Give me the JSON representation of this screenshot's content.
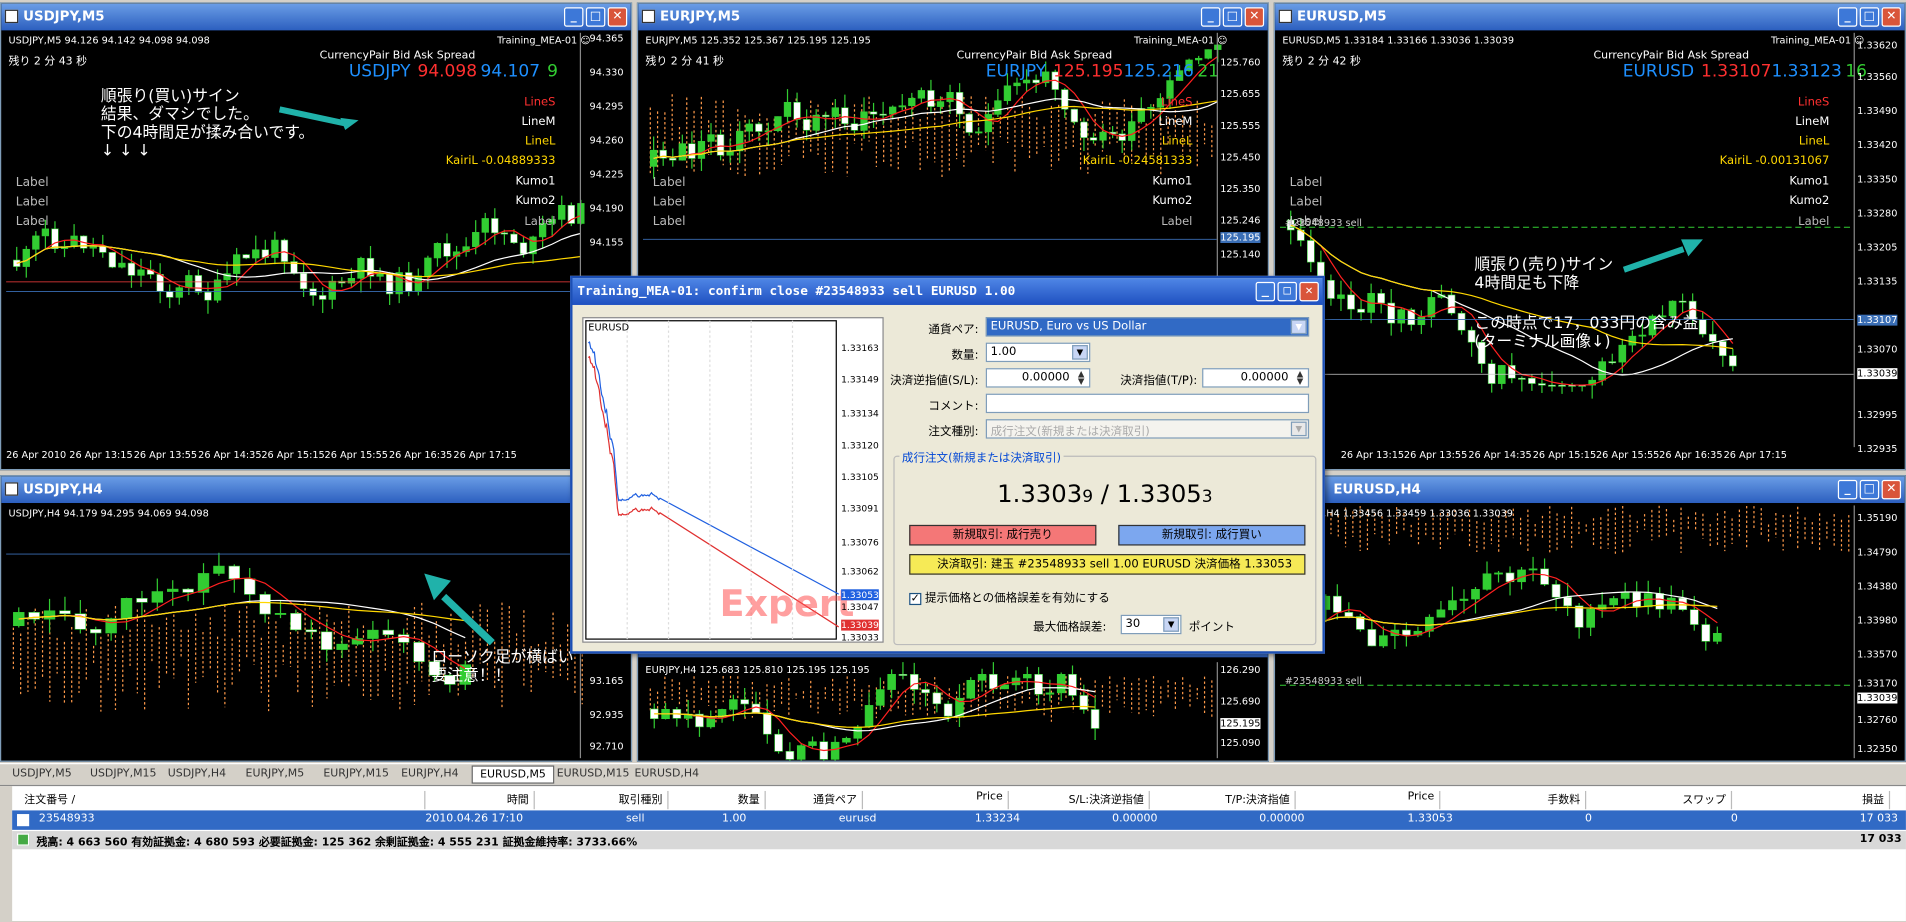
{
  "colors": {
    "bull_candle": "#32cd32",
    "bear_candle": "#ffffff",
    "ma_fast": "#ff2020",
    "ma_slow": "#ffffff",
    "ma_yellow": "#ffd700",
    "kumo": "#ff9a4a",
    "annotation_arrow": "#20b2aa"
  },
  "windows": {
    "usdjpy_m5": {
      "title": "USDJPY,M5",
      "header": "USDJPY,M5  94.126 94.142 94.098 94.098",
      "remaining": "残り 2 分 43 秒",
      "ea": "Training_MEA-01 ☺",
      "qh": "CurrencyPair        Bid         Ask    Spread",
      "sym": "USDJPY",
      "bid": "94.098",
      "ask": "94.107",
      "spread": "9",
      "ind": [
        "LineS",
        "LineM",
        "LineL",
        "KairiL  -0.04889333",
        "Kumo1",
        "Kumo2",
        "Label"
      ],
      "labels": [
        "Label",
        "Label",
        "Label"
      ],
      "prices": [
        "94.365",
        "94.330",
        "94.295",
        "94.260",
        "94.225",
        "94.190",
        "94.155"
      ],
      "times": [
        "26 Apr 2010",
        "26 Apr 13:15",
        "26 Apr 13:55",
        "26 Apr 14:35",
        "26 Apr 15:15",
        "26 Apr 15:55",
        "26 Apr 16:35",
        "26 Apr 17:15"
      ],
      "note": [
        "順張り(買い)サイン",
        "結果、ダマシでした。",
        "下の4時間足が揉み合いです。",
        "↓  ↓  ↓"
      ]
    },
    "eurjpy_m5": {
      "title": "EURJPY,M5",
      "header": "EURJPY,M5  125.352 125.367 125.195 125.195",
      "remaining": "残り 2 分 41 秒",
      "ea": "Training_MEA-01 ☺",
      "qh": "CurrencyPair        Bid         Ask    Spread",
      "sym": "EURJPY",
      "bid": "125.195",
      "ask": "125.216",
      "spread": "21",
      "ind": [
        "LineS",
        "LineM",
        "LineL",
        "KairiL  -0.24581333",
        "Kumo1",
        "Kumo2",
        "Label"
      ],
      "labels": [
        "Label",
        "Label",
        "Label"
      ],
      "prices": [
        "125.760",
        "125.655",
        "125.555",
        "125.450",
        "125.350",
        "125.246",
        "125.195",
        "125.140"
      ]
    },
    "eurusd_m5": {
      "title": "EURUSD,M5",
      "header": "EURUSD,M5  1.33184 1.33166 1.33036 1.33039",
      "remaining": "残り 2 分 42 秒",
      "ea": "Training_MEA-01 ☺",
      "qh": "CurrencyPair        Bid         Ask    Spread",
      "sym": "EURUSD",
      "bid": "1.33107",
      "ask": "1.33123",
      "spread": "16",
      "ind": [
        "LineS",
        "LineM",
        "LineL",
        "KairiL  -0.00131067",
        "Kumo1",
        "Kumo2",
        "Label"
      ],
      "labels": [
        "Label",
        "Label",
        "Label"
      ],
      "order": "#23548933 sell",
      "prices": [
        "1.33620",
        "1.33560",
        "1.33490",
        "1.33420",
        "1.33350",
        "1.33280",
        "1.33205",
        "1.33135",
        "1.33107",
        "1.33070",
        "1.33039",
        "1.32995",
        "1.32935"
      ],
      "times": [
        "26 Apr 13:15",
        "26 Apr 13:55",
        "26 Apr 14:35",
        "26 Apr 15:15",
        "26 Apr 15:55",
        "26 Apr 16:35",
        "26 Apr 17:15"
      ],
      "note1": [
        "順張り(売り)サイン",
        "4時間足も下降"
      ],
      "note2": [
        "この時点で17，033円の含み益",
        "(ターミナル画像↓)"
      ]
    },
    "usdjpy_h4": {
      "title": "USDJPY,H4",
      "header": "USDJPY,H4  94.179 94.295 94.069 94.098",
      "prices": [
        "93.165",
        "92.935",
        "92.710"
      ],
      "note": [
        "ローソク足が横ばい",
        "要注意！！"
      ]
    },
    "eurjpy_h4": {
      "header": "EURJPY,H4  125.683 125.810 125.195 125.195",
      "prices": [
        "126.290",
        "125.690",
        "125.195",
        "125.090"
      ]
    },
    "eurusd_h4": {
      "title": "EURUSD,H4",
      "header": "EURUSD,H4  1.33456 1.33459 1.33036 1.33039",
      "order": "#23548933 sell",
      "prices": [
        "1.35190",
        "1.34790",
        "1.34380",
        "1.33980",
        "1.33570",
        "1.33170",
        "1.33039",
        "1.32760",
        "1.32350"
      ]
    }
  },
  "dialog": {
    "title": "Training_MEA-01: confirm close #23548933 sell EURUSD 1.00",
    "mini_symbol": "EURUSD",
    "mini_prices": [
      "1.33163",
      "1.33149",
      "1.33134",
      "1.33120",
      "1.33105",
      "1.33091",
      "1.33076",
      "1.33062",
      "1.33053",
      "1.33047",
      "1.33039",
      "1.33033"
    ],
    "watermark": "Expert",
    "pair_label": "通貨ペア:",
    "pair_value": "EURUSD, Euro vs US Dollar",
    "qty_label": "数量:",
    "qty_value": "1.00",
    "sl_label": "決済逆指値(S/L):",
    "sl_value": "0.00000",
    "tp_label": "決済指値(T/P):",
    "tp_value": "0.00000",
    "comment_label": "コメント:",
    "type_label": "注文種別:",
    "type_value": "成行注文(新規または決済取引)",
    "group_title": "成行注文(新規または決済取引)",
    "bid_main": "1.3303",
    "bid_small": "9",
    "sep": " / ",
    "ask_main": "1.3305",
    "ask_small": "3",
    "sell_btn": "新規取引:  成行売り",
    "buy_btn": "新規取引:  成行買い",
    "close_btn": "決済取引:  建玉  #23548933 sell 1.00 EURUSD  決済価格  1.33053",
    "check_label": "提示価格との価格誤差を有効にする",
    "dev_label": "最大価格誤差:",
    "dev_value": "30",
    "dev_unit": "ポイント"
  },
  "tabs": [
    "USDJPY,M5",
    "USDJPY,M15",
    "USDJPY,H4",
    "EURJPY,M5",
    "EURJPY,M15",
    "EURJPY,H4",
    "EURUSD,M5",
    "EURUSD,M15",
    "EURUSD,H4"
  ],
  "active_tab": "EURUSD,M5",
  "terminal": {
    "headers": [
      "注文番号 /",
      "時間",
      "取引種別",
      "数量",
      "通貨ペア",
      "Price",
      "S/L:決済逆指値",
      "T/P:決済指値",
      "Price",
      "手数料",
      "スワップ",
      "損益"
    ],
    "row": {
      "ticket": "23548933",
      "time": "2010.04.26 17:10",
      "type": "sell",
      "size": "1.00",
      "symbol": "eurusd",
      "open": "1.33234",
      "sl": "0.00000",
      "tp": "0.00000",
      "price": "1.33053",
      "commission": "0",
      "swap": "0",
      "profit": "17 033"
    },
    "summary": "残高: 4 663 560  有効証拠金: 4 680 593  必要証拠金: 125 362  余剰証拠金: 4 555 231  証拠金維持率: 3733.66%",
    "summary_profit": "17 033"
  }
}
